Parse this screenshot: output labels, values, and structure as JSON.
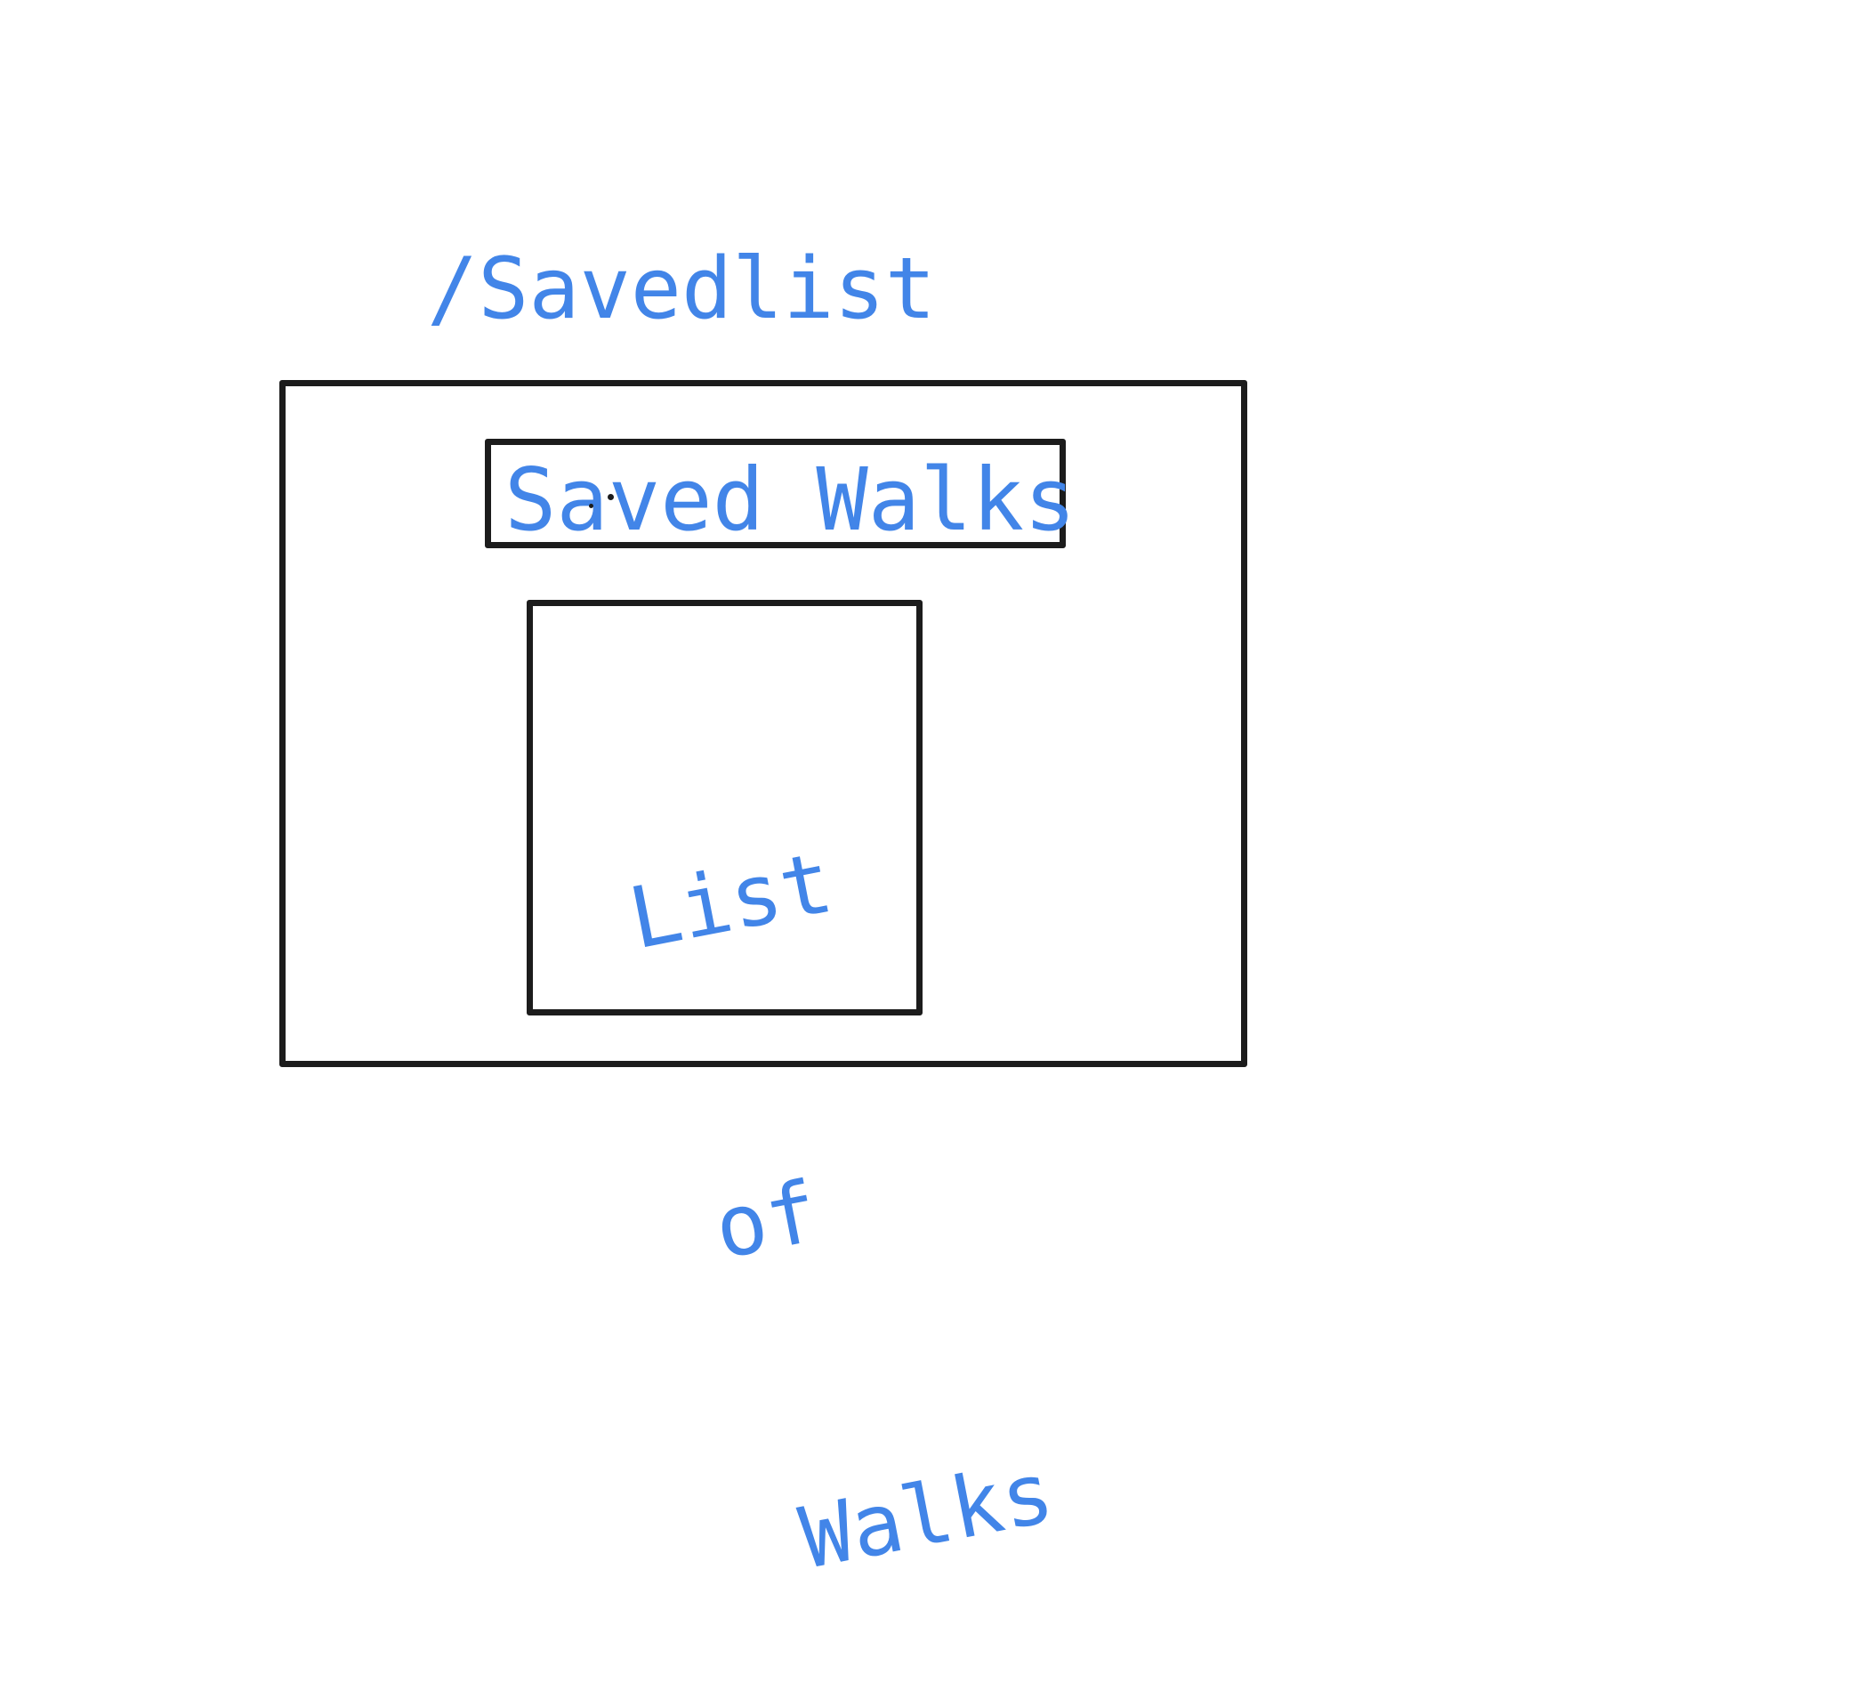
{
  "route": "/Savedlist",
  "header": {
    "title": "Saved Walks"
  },
  "list": {
    "placeholder_line1": "List",
    "placeholder_line2": "of",
    "placeholder_line3": "Walks"
  },
  "colors": {
    "ink": "#4285e8",
    "stroke": "#1c1c1c",
    "background": "#ffffff"
  }
}
